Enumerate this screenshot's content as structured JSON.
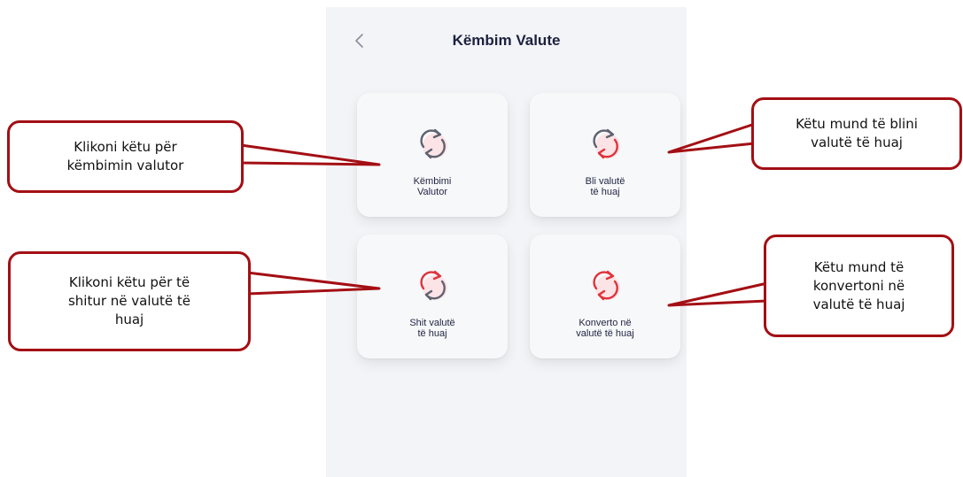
{
  "screen": {
    "back_icon": "chevron-left-icon",
    "title": "Këmbim Valute"
  },
  "tiles": [
    {
      "icon": "exchange-arrows-icon",
      "lines": [
        "Këmbimi",
        "Valutor"
      ]
    },
    {
      "icon": "exchange-arrows-icon",
      "lines": [
        "Bli valutë",
        "të huaj"
      ]
    },
    {
      "icon": "exchange-arrows-icon",
      "lines": [
        "Shit valutë",
        "të huaj"
      ]
    },
    {
      "icon": "exchange-arrows-icon",
      "lines": [
        "Konverto në",
        "valutë të huaj"
      ]
    }
  ],
  "callouts": [
    {
      "lines": [
        "Klikoni këtu për",
        "këmbimin valutor"
      ]
    },
    {
      "lines": [
        "Këtu mund të blini",
        "valutë të huaj"
      ]
    },
    {
      "lines": [
        "Klikoni këtu për të",
        "shitur në valutë të",
        "huaj"
      ]
    },
    {
      "lines": [
        "Këtu mund të",
        "konvertoni në",
        "valutë të huaj"
      ]
    }
  ],
  "colors": {
    "callout_border": "#a30f14",
    "icon_stroke": "#5f6270",
    "icon_accent": "#e0323a",
    "icon_bubble": "#fbe3e6",
    "background": "#f3f4f7"
  }
}
